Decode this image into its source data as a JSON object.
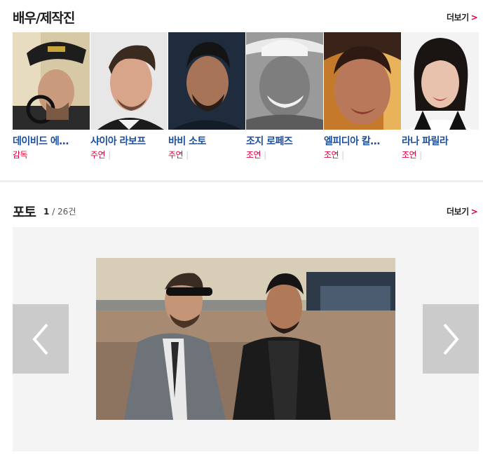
{
  "cast_section": {
    "title": "배우/제작진",
    "more_label": "더보기",
    "items": [
      {
        "name": "데이비드 에…",
        "role": "감독"
      },
      {
        "name": "샤이아 라보프",
        "role": "주연"
      },
      {
        "name": "바비 소토",
        "role": "주연"
      },
      {
        "name": "조지 로페즈",
        "role": "조연"
      },
      {
        "name": "엘피디아 칼…",
        "role": "조연"
      },
      {
        "name": "라나 파릴라",
        "role": "조연"
      }
    ]
  },
  "photo_section": {
    "title": "포토",
    "current": "1",
    "total": "/ 26건",
    "more_label": "더보기"
  },
  "colors": {
    "name_blue": "#1a4e9e",
    "role_red": "#e0003c",
    "nav_gray": "#cbcbcb",
    "gallery_bg": "#f4f4f4"
  },
  "icons": [
    "chevron-right-icon",
    "arrow-left-icon",
    "arrow-right-icon"
  ]
}
